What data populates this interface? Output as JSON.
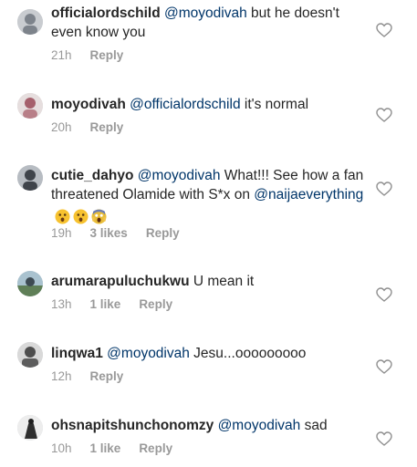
{
  "comments": [
    {
      "username": "officialordschild",
      "mention": "@moyodivah",
      "text": " but he doesn't even know you",
      "time": "21h",
      "likes": "",
      "reply": "Reply",
      "avatar_color": "#8a9099"
    },
    {
      "username": "moyodivah",
      "mention": "@officialordschild",
      "text": " it's normal",
      "time": "20h",
      "likes": "",
      "reply": "Reply",
      "avatar_color": "#c25a6a"
    },
    {
      "username": "cutie_dahyo",
      "mention": "@moyodivah",
      "text": " What!!! See how a fan threatened Olamide with S*x on ",
      "mention2": "@naijaeverything",
      "time": "19h",
      "likes": "3 likes",
      "reply": "Reply",
      "avatar_color": "#4a4f57"
    },
    {
      "username": "arumarapuluchukwu",
      "mention": "",
      "text": " U mean it",
      "time": "13h",
      "likes": "1 like",
      "reply": "Reply",
      "avatar_color": "#6c8fa3"
    },
    {
      "username": "linqwa1",
      "mention": "@moyodivah",
      "text": " Jesu...ooooooooo",
      "time": "12h",
      "likes": "",
      "reply": "Reply",
      "avatar_color": "#5d5d5d"
    },
    {
      "username": "ohsnapitshunchonomzy",
      "mention": "@moyodivah",
      "text": " sad",
      "time": "10h",
      "likes": "1 like",
      "reply": "Reply",
      "avatar_color": "#3a3a3a"
    }
  ],
  "colors": {
    "text": "#262626",
    "mention": "#003569",
    "meta": "#999999"
  },
  "icons": {
    "like": "heart-outline-icon",
    "emoji_1": "astonished-face-icon",
    "emoji_2": "astonished-face-icon",
    "emoji_3": "screaming-face-icon"
  }
}
